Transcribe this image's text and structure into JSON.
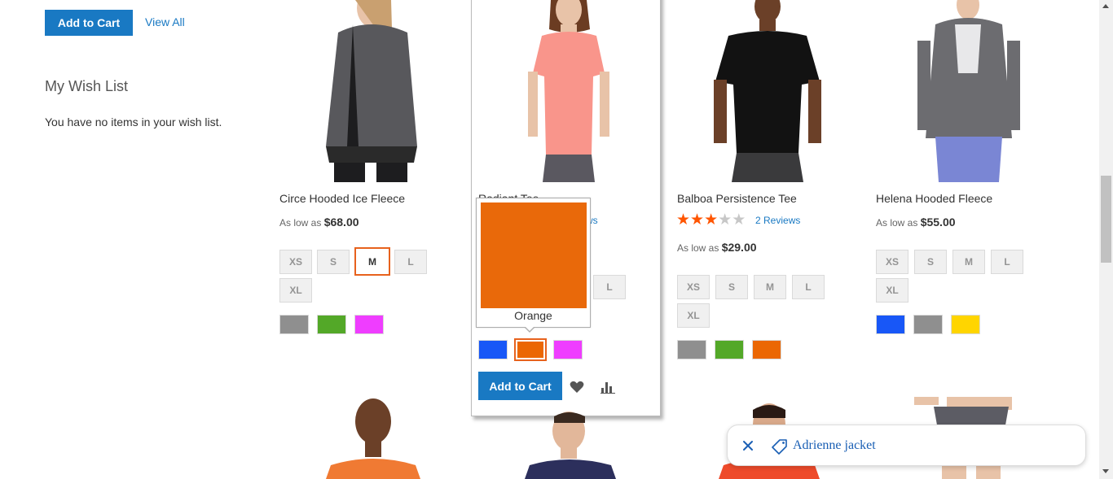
{
  "sidebar": {
    "add_to_cart_label": "Add to Cart",
    "view_all_label": "View All",
    "wishlist_title": "My Wish List",
    "wishlist_empty": "You have no items in your wish list."
  },
  "products": [
    {
      "name": "Circe Hooded Ice Fleece",
      "price_prefix": "As low as",
      "price": "$68.00",
      "sizes": [
        "XS",
        "S",
        "M",
        "L",
        "XL"
      ],
      "selected_size": "M",
      "colors": [
        "#8f8f8f",
        "#53a828",
        "#ef3dff"
      ]
    },
    {
      "name": "Radiant Tee",
      "reviews_fragment": "ws",
      "sizes_visible": [
        "L"
      ],
      "colors": [
        "#1857f7",
        "#eb6703",
        "#ef3dff"
      ],
      "selected_color": "Orange",
      "add_to_cart_label": "Add to Cart"
    },
    {
      "name": "Balboa Persistence Tee",
      "rating_stars": 3,
      "rating_max": 5,
      "reviews_label": "2 Reviews",
      "price_prefix": "As low as",
      "price": "$29.00",
      "sizes": [
        "XS",
        "S",
        "M",
        "L",
        "XL"
      ],
      "colors": [
        "#8f8f8f",
        "#53a828",
        "#eb6703"
      ]
    },
    {
      "name": "Helena Hooded Fleece",
      "price_prefix": "As low as",
      "price": "$55.00",
      "sizes": [
        "XS",
        "S",
        "M",
        "L",
        "XL"
      ],
      "colors": [
        "#1857f7",
        "#8f8f8f",
        "#ffd500"
      ]
    }
  ],
  "tooltip": {
    "label": "Orange",
    "color": "#e9690a"
  },
  "search_chip": {
    "text": "Adrienne jacket"
  },
  "colors": {
    "primary": "#1979c3",
    "selected_outline": "#e7621d",
    "star": "#ff5501"
  }
}
